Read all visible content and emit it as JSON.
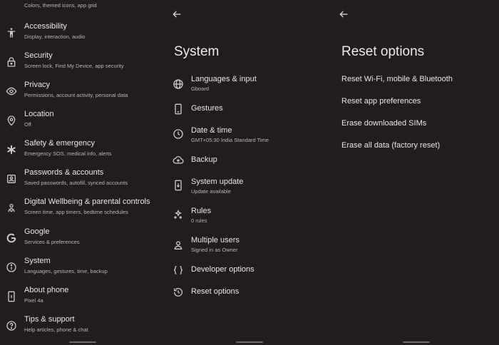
{
  "settings": {
    "top_partial_subtitle": "Colors, themed icons, app grid",
    "items": [
      {
        "icon": "accessibility-icon",
        "title": "Accessibility",
        "subtitle": "Display, interaction, audio"
      },
      {
        "icon": "lock-icon",
        "title": "Security",
        "subtitle": "Screen lock, Find My Device, app security"
      },
      {
        "icon": "privacy-eye-icon",
        "title": "Privacy",
        "subtitle": "Permissions, account activity, personal data"
      },
      {
        "icon": "location-pin-icon",
        "title": "Location",
        "subtitle": "Off"
      },
      {
        "icon": "asterisk-icon",
        "title": "Safety & emergency",
        "subtitle": "Emergency SOS, medical info, alerts"
      },
      {
        "icon": "key-badge-icon",
        "title": "Passwords & accounts",
        "subtitle": "Saved passwords, autofill, synced accounts"
      },
      {
        "icon": "wellbeing-icon",
        "title": "Digital Wellbeing & parental controls",
        "subtitle": "Screen time, app timers, bedtime schedules"
      },
      {
        "icon": "google-icon",
        "title": "Google",
        "subtitle": "Services & preferences"
      },
      {
        "icon": "info-icon",
        "title": "System",
        "subtitle": "Languages, gestures, time, backup"
      },
      {
        "icon": "phone-icon",
        "title": "About phone",
        "subtitle": "Pixel 4a"
      },
      {
        "icon": "help-icon",
        "title": "Tips & support",
        "subtitle": "Help articles, phone & chat"
      }
    ]
  },
  "system": {
    "title": "System",
    "items": [
      {
        "icon": "globe-icon",
        "title": "Languages & input",
        "subtitle": "Gboard"
      },
      {
        "icon": "gestures-phone-icon",
        "title": "Gestures",
        "subtitle": ""
      },
      {
        "icon": "clock-icon",
        "title": "Date & time",
        "subtitle": "GMT+05:30 India Standard Time"
      },
      {
        "icon": "cloud-upload-icon",
        "title": "Backup",
        "subtitle": ""
      },
      {
        "icon": "system-update-icon",
        "title": "System update",
        "subtitle": "Update available"
      },
      {
        "icon": "rules-icon",
        "title": "Rules",
        "subtitle": "0 rules"
      },
      {
        "icon": "person-icon",
        "title": "Multiple users",
        "subtitle": "Signed in as Owner"
      },
      {
        "icon": "braces-icon",
        "title": "Developer options",
        "subtitle": ""
      },
      {
        "icon": "history-icon",
        "title": "Reset options",
        "subtitle": ""
      }
    ]
  },
  "reset": {
    "title": "Reset options",
    "items": [
      "Reset Wi-Fi, mobile & Bluetooth",
      "Reset app preferences",
      "Erase downloaded SIMs",
      "Erase all data (factory reset)"
    ]
  },
  "colors": {
    "background": "#201c1f",
    "text_primary": "#ece6e9",
    "text_secondary": "#bdb4b9"
  }
}
